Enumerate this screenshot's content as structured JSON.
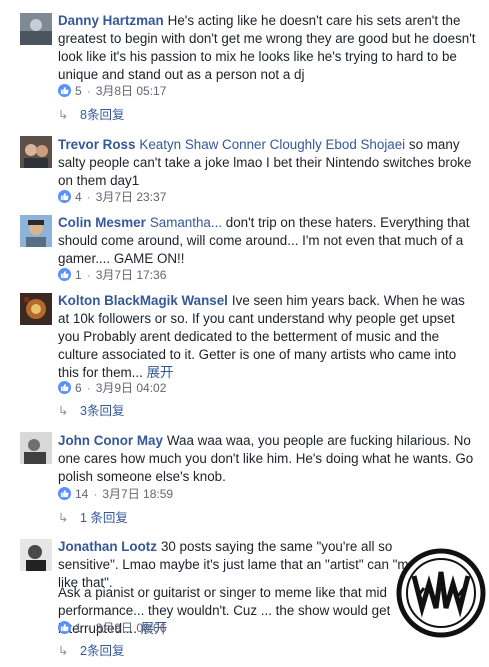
{
  "comments": [
    {
      "author": "Danny Hartzman",
      "mentions": "",
      "text": "He's acting like he doesn't care his sets aren't the greatest to begin with don't get me wrong they are good but he doesn't look like it's his passion to mix he looks like he's trying to hard to be unique and stand out as a person not a dj",
      "see_more": "",
      "likes": "5",
      "date": "3月8日 05:17",
      "replies": "8条回复"
    },
    {
      "author": "Trevor Ross",
      "mentions": "Keatyn Shaw Conner Cloughly Ebod Shojaei",
      "text": "so many salty people can't take a joke lmao I bet their Nintendo switches broke on them day1",
      "see_more": "",
      "likes": "4",
      "date": "3月7日 23:37",
      "replies": ""
    },
    {
      "author": "Colin Mesmer",
      "mentions": "Samantha...",
      "text": "don't trip on these haters. Everything that should come around, will come around... I'm not even that much of a gamer.... GAME ON!!",
      "see_more": "",
      "likes": "1",
      "date": "3月7日 17:36",
      "replies": ""
    },
    {
      "author": "Kolton BlackMagik Wansel",
      "mentions": "",
      "text": "Ive seen him years back. When he was at 10k followers or so. If you cant understand why people get upset you Probably arent dedicated to the betterment of music and the culture associated to it. Getter is one of many artists who came into this for them...",
      "see_more": "展开",
      "likes": "6",
      "date": "3月9日 04:02",
      "replies": "3条回复"
    },
    {
      "author": "John Conor May",
      "mentions": "",
      "text": "Waa waa waa, you people are fucking hilarious. No one cares how much you don't like him. He's doing what he wants. Go polish someone else's knob.",
      "see_more": "",
      "likes": "14",
      "date": "3月7日 18:59",
      "replies": "1 条回复"
    },
    {
      "author": "Jonathan Lootz",
      "mentions": "",
      "text": "30 posts saying the same \"you're all so sensitive\". Lmao maybe it's just lame that an \"artist\" can \"meme like that\".",
      "text2": "Ask a pianist or guitarist or singer to meme like that mid performance... they wouldn't. Cuz ... the show would get interrupted....",
      "see_more": "展开",
      "likes": "1",
      "date": "3月9日 08:06",
      "replies": "2条回复"
    }
  ],
  "colors": {
    "link": "#365899",
    "text": "#1d2129",
    "meta": "#616770",
    "like": "#5890ff"
  }
}
